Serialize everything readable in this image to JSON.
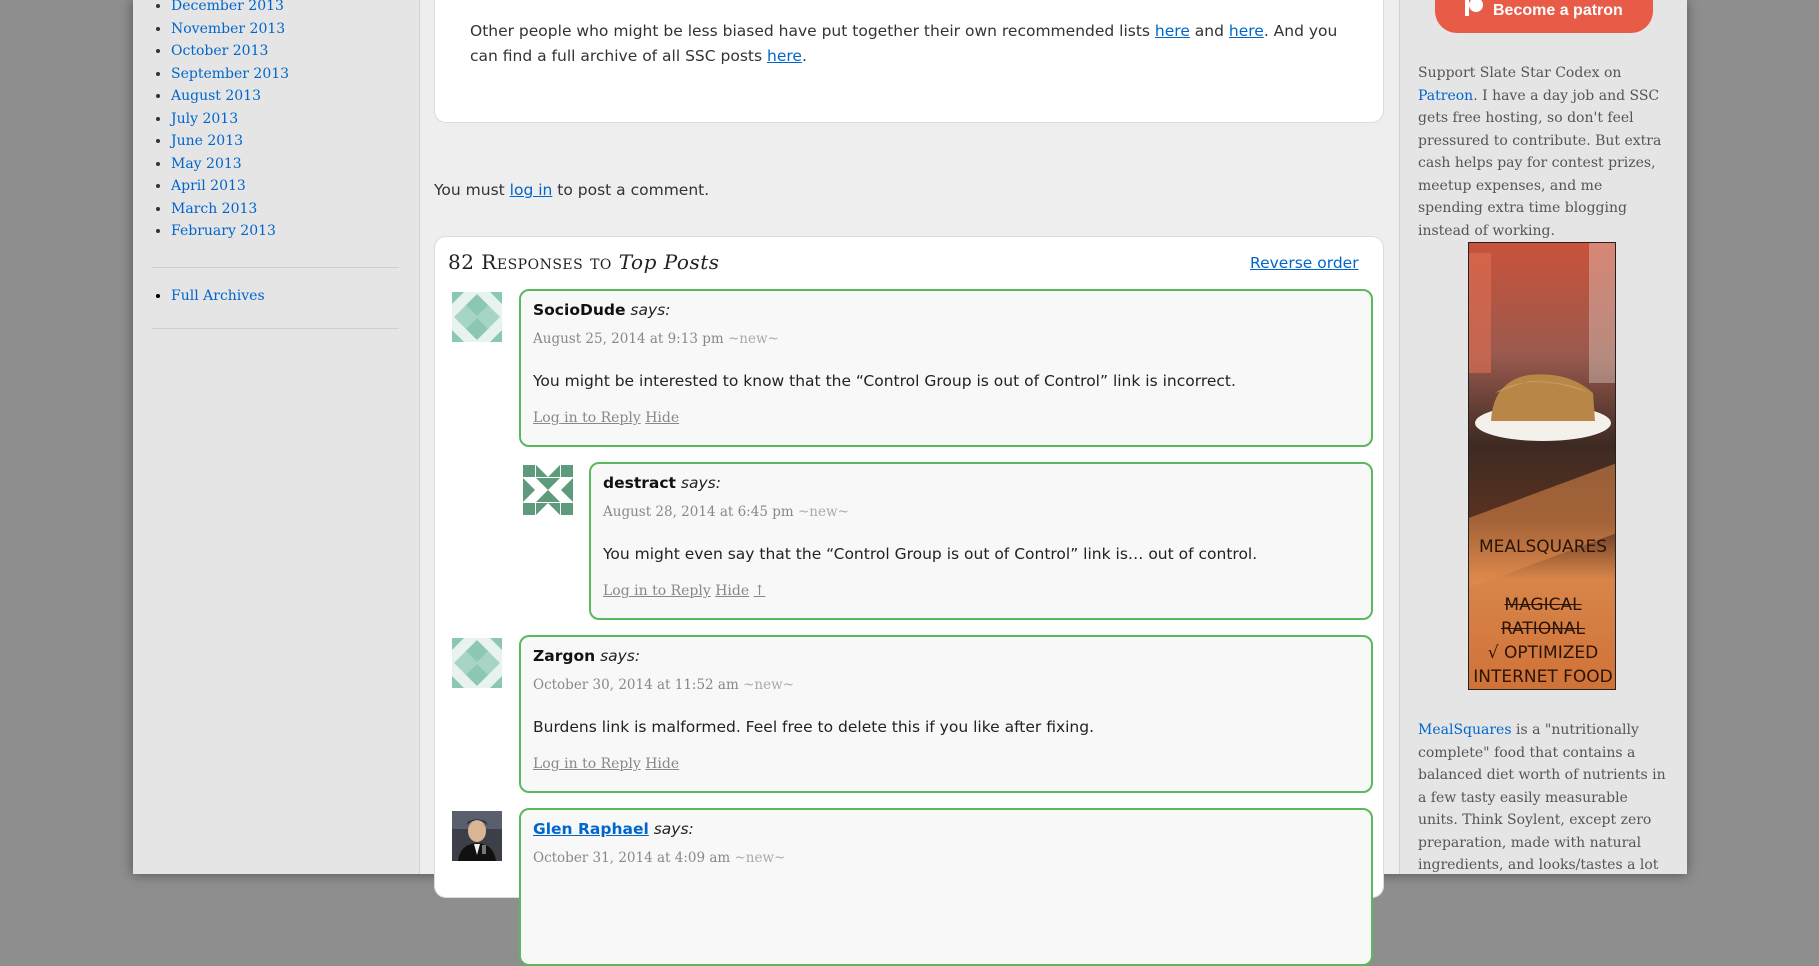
{
  "archives": [
    "December 2013",
    "November 2013",
    "October 2013",
    "September 2013",
    "August 2013",
    "July 2013",
    "June 2013",
    "May 2013",
    "April 2013",
    "March 2013",
    "February 2013"
  ],
  "full_archives": "Full Archives",
  "post_footer": {
    "p1": "Other people who might be less biased have put together their own recommended lists ",
    "link1": "here",
    "and": " and ",
    "link2": "here",
    "p2": ". And you can find a full archive of all SSC posts ",
    "link3": "here",
    "end": "."
  },
  "login_prompt": {
    "pre": "You must ",
    "link": "log in",
    "post": " to post a comment."
  },
  "responses": {
    "count_text": "82 Responses to ",
    "title": "Top Posts",
    "reverse": "Reverse order"
  },
  "comments": [
    {
      "author": "SocioDude",
      "says": "says:",
      "date": "August 25, 2014 at 9:13 pm",
      "new": "~new~",
      "text": "You might be interested to know that the “Control Group is out of Control” link is incorrect.",
      "reply": "Log in to Reply",
      "hide": "Hide",
      "extra": ""
    },
    {
      "author": "destract",
      "says": "says:",
      "date": "August 28, 2014 at 6:45 pm",
      "new": "~new~",
      "text": "You might even say that the “Control Group is out of Control” link is… out of control.",
      "reply": "Log in to Reply",
      "hide": "Hide",
      "extra": "↑"
    },
    {
      "author": "Zargon",
      "says": "says:",
      "date": "October 30, 2014 at 11:52 am",
      "new": "~new~",
      "text": "Burdens link is malformed. Feel free to delete this if you like after fixing.",
      "reply": "Log in to Reply",
      "hide": "Hide",
      "extra": ""
    },
    {
      "author": "Glen Raphael",
      "says": "says:",
      "date": "October 31, 2014 at 4:09 am",
      "new": "~new~",
      "text": "",
      "reply": "",
      "hide": "",
      "extra": ""
    }
  ],
  "sidebar": {
    "patron_button": "Become a patron",
    "support_pre": "Support Slate Star Codex on ",
    "patreon": "Patreon",
    "support_post": ". I have a day job and SSC gets free hosting, so don't feel pressured to contribute. But extra cash helps pay for contest prizes, meetup expenses, and me spending extra time blogging instead of working.",
    "ad_brand": "MEALSQUARES",
    "ad_line1": "MAGICAL",
    "ad_line2": "RATIONAL",
    "ad_line3": "√ OPTIMIZED",
    "ad_line4": "INTERNET FOOD",
    "meal_link": "MealSquares",
    "meal_text": " is a \"nutritionally complete\" food that contains a balanced diet worth of nutrients in a few tasty easily measurable units. Think Soylent, except zero preparation, made with natural ingredients, and looks/tastes a lot"
  },
  "colors": {
    "link": "#0066cc",
    "comment_border": "#5cb85c",
    "patron": "#e85b46"
  }
}
